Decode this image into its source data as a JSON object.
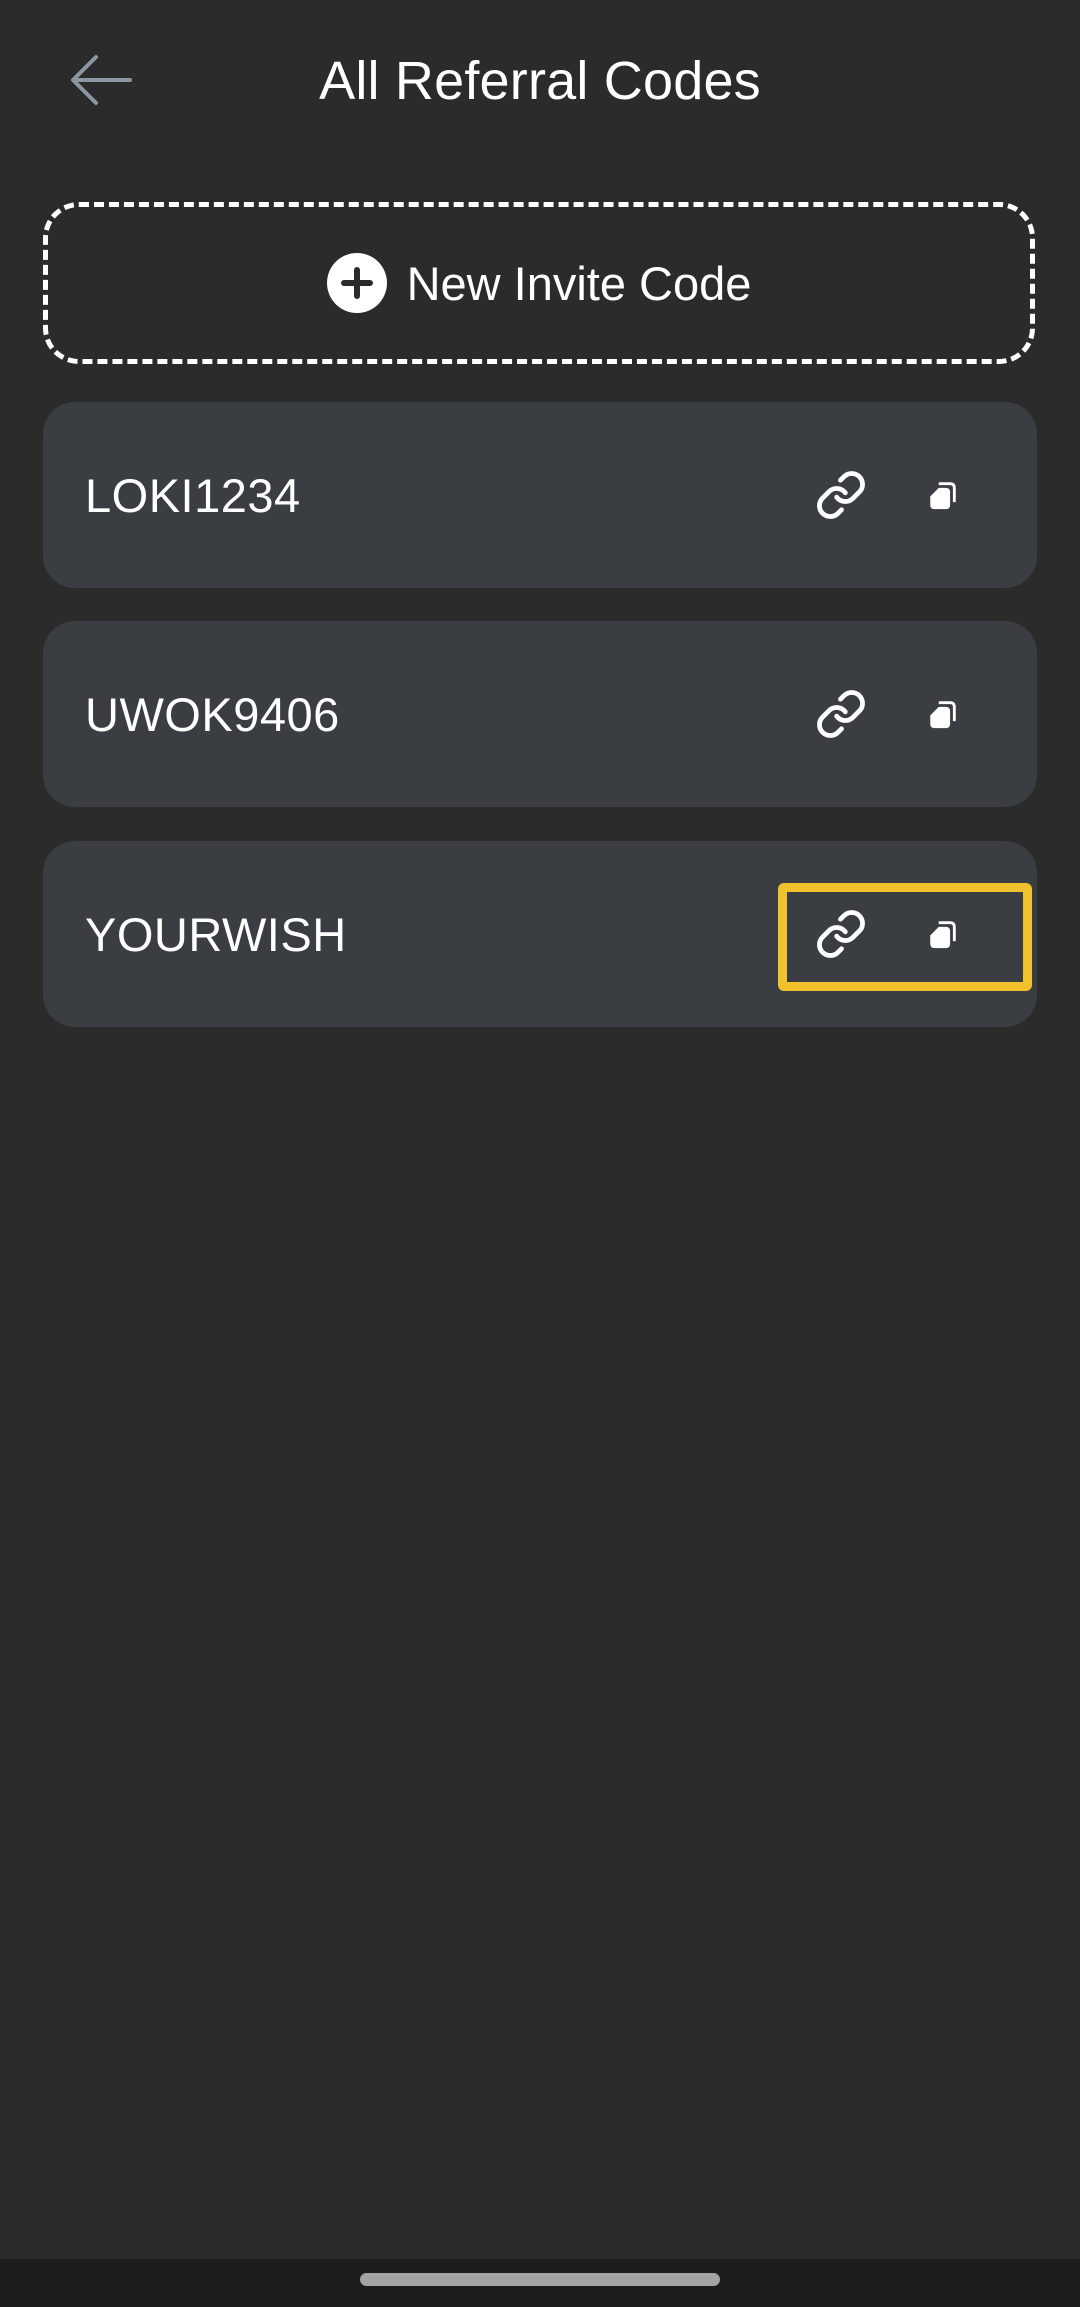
{
  "header": {
    "title": "All Referral Codes",
    "back_icon": "arrow-left-icon"
  },
  "new_code_button": {
    "label": "New Invite Code",
    "icon": "plus-circle-icon"
  },
  "codes": [
    {
      "code": "LOKI1234",
      "link_icon": "link-icon",
      "copy_icon": "copy-icon"
    },
    {
      "code": "UWOK9406",
      "link_icon": "link-icon",
      "copy_icon": "copy-icon"
    },
    {
      "code": "YOURWISH",
      "link_icon": "link-icon",
      "copy_icon": "copy-icon",
      "highlighted": true
    }
  ],
  "colors": {
    "background": "#2b2b2b",
    "card": "#3a3d41",
    "text": "#ffffff",
    "back_arrow": "#8e96a3",
    "highlight": "#f2c12e",
    "nav_bar": "#1d1d1d",
    "home_indicator": "#a3a3a3"
  }
}
